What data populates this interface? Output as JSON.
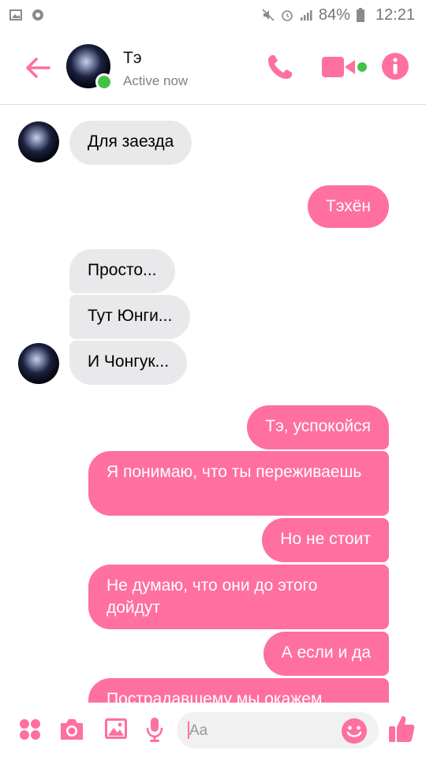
{
  "status_bar": {
    "battery": "84%",
    "time": "12:21"
  },
  "header": {
    "contact_name": "Тэ",
    "contact_status": "Active now",
    "online": true
  },
  "colors": {
    "accent": "#ff6fa0",
    "incoming_bubble": "#e9e9eb",
    "online": "#43c147"
  },
  "messages": [
    {
      "direction": "in",
      "text": "Для заезда"
    },
    {
      "direction": "out",
      "text": "Тэхён"
    },
    {
      "direction": "in",
      "text": "Просто..."
    },
    {
      "direction": "in",
      "text": "Тут Юнги..."
    },
    {
      "direction": "in",
      "text": "И Чонгук..."
    },
    {
      "direction": "out",
      "text": "Тэ, успокойся"
    },
    {
      "direction": "out",
      "text": "Я понимаю, что ты переживаешь"
    },
    {
      "direction": "out",
      "text": "Но не стоит"
    },
    {
      "direction": "out",
      "text": "Не думаю, что они до этого дойдут"
    },
    {
      "direction": "out",
      "text": "А если и да"
    },
    {
      "direction": "out",
      "text": "Пострадавшему мы окажем"
    }
  ],
  "composer": {
    "placeholder": "Aa"
  },
  "icons": {
    "back": "arrow-left-icon",
    "call": "phone-icon",
    "video": "video-camera-icon",
    "info": "info-icon",
    "more": "grid-dots-icon",
    "camera": "camera-icon",
    "gallery": "image-icon",
    "mic": "microphone-icon",
    "emoji": "emoji-icon",
    "like": "thumbs-up-icon"
  }
}
